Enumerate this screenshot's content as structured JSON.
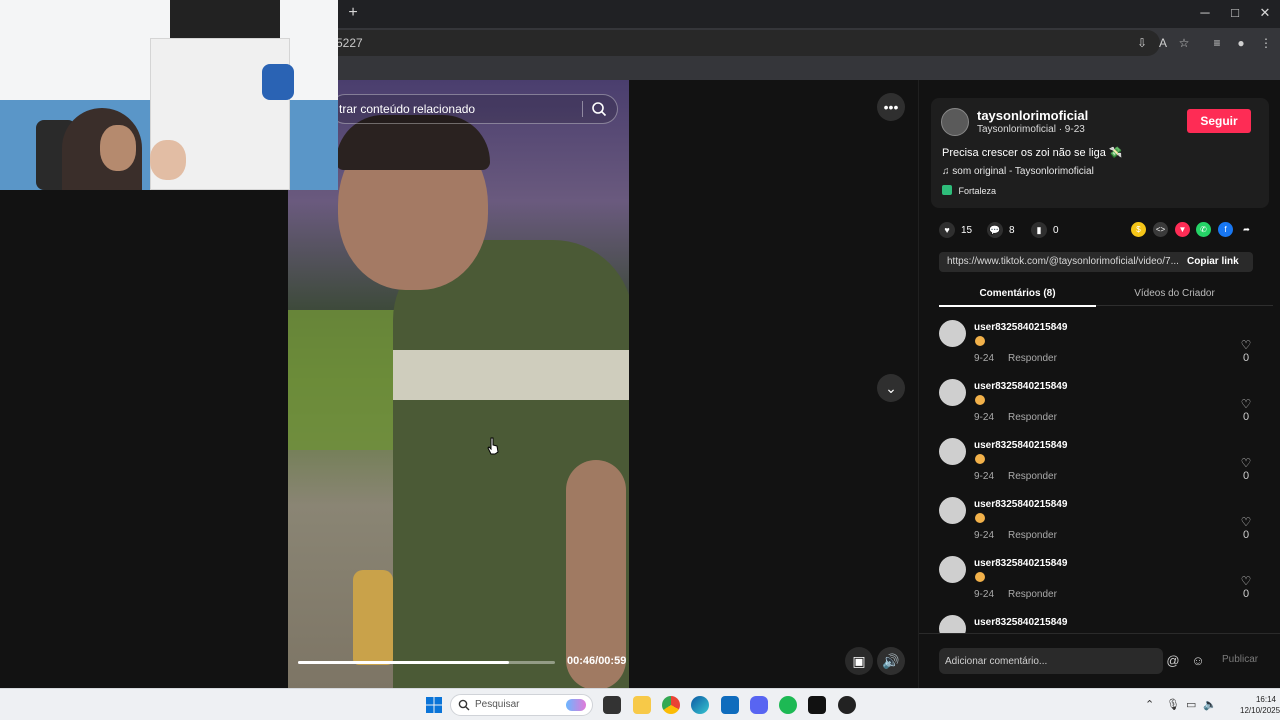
{
  "browser": {
    "new_tab": "+",
    "minimize": "─",
    "maximize": "□",
    "close": "✕",
    "address": "5227"
  },
  "video": {
    "search_placeholder": "trar conteúdo relacionado",
    "time": "00:46/00:59",
    "progress": 0.82
  },
  "creator": {
    "username": "taysonlorimoficial",
    "subline": "Taysonlorimoficial · 9-23",
    "follow_label": "Seguir",
    "caption": "Precisa crescer os zoi não se liga 💸",
    "music": "som original - Taysonlorimoficial",
    "location": "Fortaleza"
  },
  "stats": {
    "likes": "15",
    "comments": "8",
    "saves": "0"
  },
  "share": {
    "link": "https://www.tiktok.com/@taysonlorimoficial/video/7...",
    "copy_label": "Copiar link"
  },
  "tabs": {
    "comments": "Comentários (8)",
    "creator_videos": "Vídeos do Criador"
  },
  "comments": [
    {
      "user": "user8325840215849",
      "date": "9-24",
      "reply": "Responder",
      "likes": "0"
    },
    {
      "user": "user8325840215849",
      "date": "9-24",
      "reply": "Responder",
      "likes": "0"
    },
    {
      "user": "user8325840215849",
      "date": "9-24",
      "reply": "Responder",
      "likes": "0"
    },
    {
      "user": "user8325840215849",
      "date": "9-24",
      "reply": "Responder",
      "likes": "0"
    },
    {
      "user": "user8325840215849",
      "date": "9-24",
      "reply": "Responder",
      "likes": "0"
    },
    {
      "user": "user8325840215849",
      "date": "",
      "reply": "",
      "likes": ""
    }
  ],
  "composer": {
    "placeholder": "Adicionar comentário...",
    "publish_label": "Publicar"
  },
  "taskbar": {
    "search_placeholder": "Pesquisar",
    "time": "16:14",
    "date": "12/10/2025"
  },
  "colors": {
    "accent": "#fe2c55",
    "panel_bg": "#121212",
    "card_bg": "#1e1e1e"
  }
}
